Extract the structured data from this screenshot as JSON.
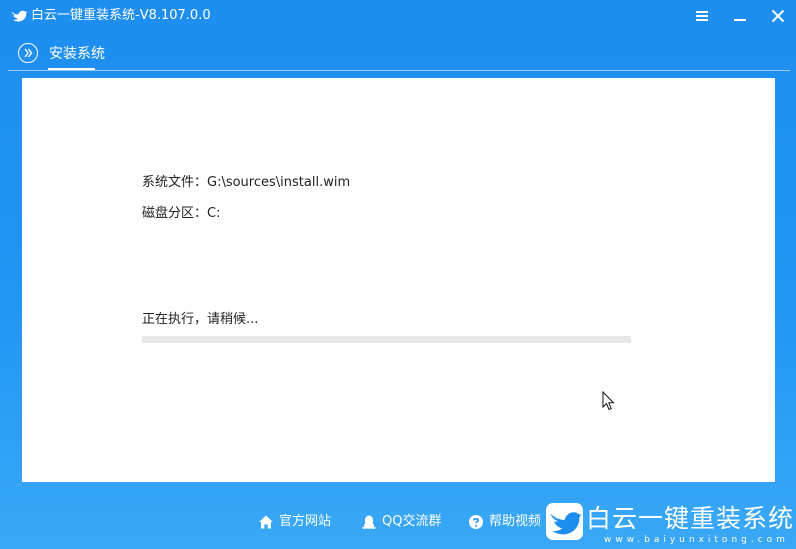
{
  "window": {
    "title": "白云一键重装系统-V8.107.0.0",
    "icons": [
      "bird-logo-icon",
      "menu-icon",
      "minimize-icon",
      "close-icon"
    ]
  },
  "tabs": [
    {
      "label": "安装系统",
      "icon": "chevron-double-right-icon",
      "active": true
    }
  ],
  "install": {
    "file_line": "系统文件：G:\\sources\\install.wim",
    "partition_line": "磁盘分区：C:",
    "status_text": "正在执行，请稍候...",
    "progress_percent": 0
  },
  "footer": {
    "links": [
      {
        "label": "官方网站",
        "icon": "home-icon"
      },
      {
        "label": "QQ交流群",
        "icon": "qq-penguin-icon"
      },
      {
        "label": "帮助视频",
        "icon": "help-icon"
      }
    ]
  },
  "watermark": {
    "name": "白云一键重装系统",
    "url": "www.baiyunxitong.com"
  },
  "colors": {
    "accent": "#2196f3",
    "panel": "#ffffff",
    "progress_track": "#e7e7e7",
    "text_dark": "#222222"
  }
}
